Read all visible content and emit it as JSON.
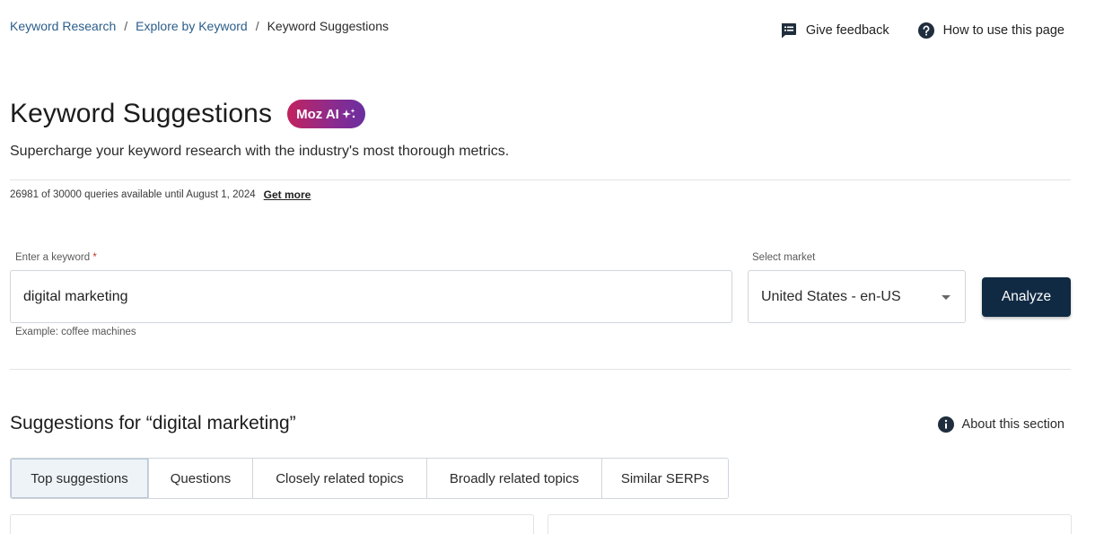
{
  "breadcrumb": {
    "items": [
      "Keyword Research",
      "Explore by Keyword",
      "Keyword Suggestions"
    ],
    "separator": "/"
  },
  "top_actions": {
    "feedback_label": "Give feedback",
    "howto_label": "How to use this page"
  },
  "header": {
    "title": "Keyword Suggestions",
    "badge": "Moz AI",
    "subtitle": "Supercharge your keyword research with the industry's most thorough metrics."
  },
  "quota": {
    "text": "26981 of 30000 queries available until August 1, 2024",
    "link": "Get more"
  },
  "form": {
    "keyword_label": "Enter a keyword",
    "keyword_required_mark": "*",
    "keyword_value": "digital marketing",
    "keyword_helper": "Example: coffee machines",
    "market_label": "Select market",
    "market_value": "United States - en-US",
    "analyze_label": "Analyze"
  },
  "suggestions": {
    "title": "Suggestions for “digital marketing”",
    "about_label": "About this section",
    "tabs": [
      "Top suggestions",
      "Questions",
      "Closely related topics",
      "Broadly related topics",
      "Similar SERPs"
    ],
    "active_tab": "Top suggestions"
  },
  "colors": {
    "primary_button": "#102a43",
    "link": "#2b5d8a",
    "badge_gradient_start": "#c2225f",
    "badge_gradient_end": "#6a2ea0"
  }
}
